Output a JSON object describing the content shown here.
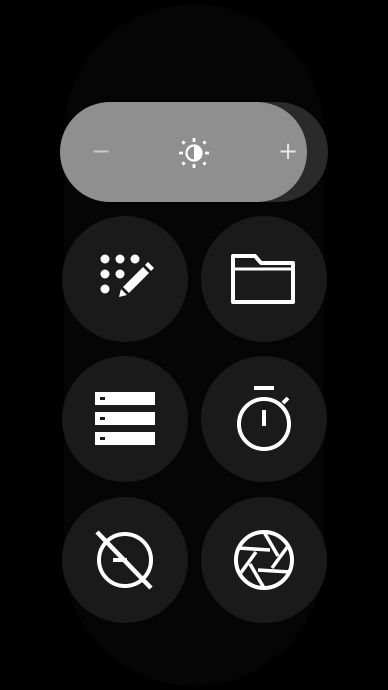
{
  "brightness": {
    "level": 0.92,
    "decrease_label": "−",
    "increase_label": "+"
  },
  "tiles": [
    {
      "icon": "watch-face-edit-icon"
    },
    {
      "icon": "folder-icon"
    },
    {
      "icon": "list-icon"
    },
    {
      "icon": "stopwatch-icon"
    },
    {
      "icon": "do-not-disturb-off-icon"
    },
    {
      "icon": "camera-aperture-icon"
    }
  ],
  "colors": {
    "background": "#000000",
    "panel": "#050505",
    "tile": "#1a1a1a",
    "slider_track": "#2a2a2a",
    "slider_fill": "#8f8f8f",
    "icon": "#ffffff"
  }
}
